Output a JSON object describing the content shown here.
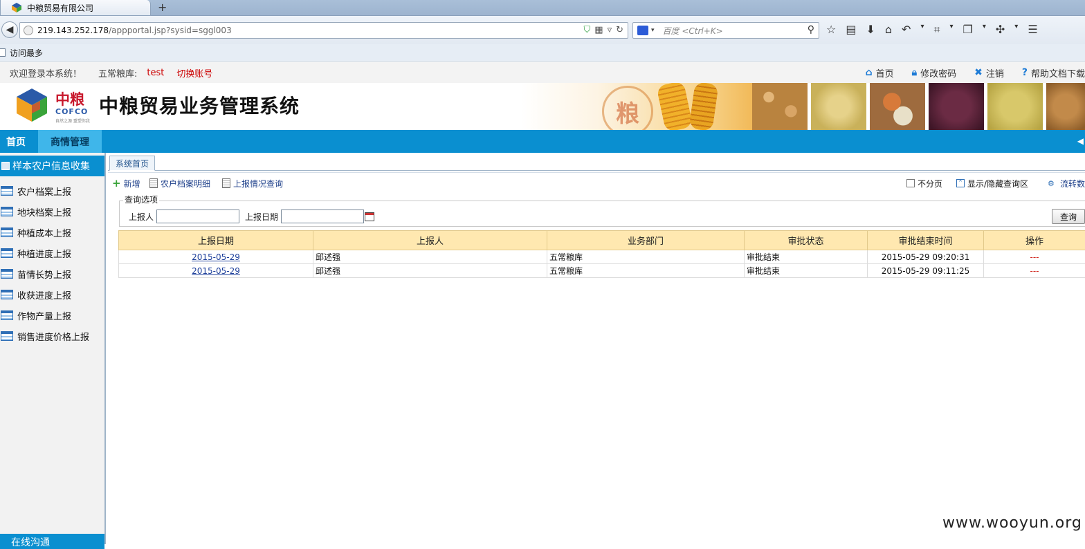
{
  "browser": {
    "tab_title": "中粮贸易有限公司",
    "new_tab": "+",
    "url_host": "219.143.252.178",
    "url_path": "/appportal.jsp?sysid=sggl003",
    "search_placeholder": "百度 <Ctrl+K>",
    "bookmark_label": "访问最多"
  },
  "topbar": {
    "welcome": "欢迎登录本系统！",
    "depot_label": "五常粮库:",
    "username": "test",
    "switch_account": "切换账号",
    "links": [
      {
        "label": "首页",
        "icon": "home-icon"
      },
      {
        "label": "修改密码",
        "icon": "lock-icon"
      },
      {
        "label": "注销",
        "icon": "close-icon"
      },
      {
        "label": "帮助文档下载",
        "icon": "help-icon"
      }
    ]
  },
  "banner": {
    "logo_cn": "中粮",
    "logo_en": "COFCO",
    "logo_tag": "自然之源 重塑你我",
    "system_title": "中粮贸易业务管理系统",
    "grain_char": "粮"
  },
  "menu": {
    "items": [
      "首页",
      "商情管理"
    ],
    "active": "商情管理"
  },
  "sidebar": {
    "header": "样本农户信息收集",
    "items": [
      "农户档案上报",
      "地块档案上报",
      "种植成本上报",
      "种植进度上报",
      "苗情长势上报",
      "收获进度上报",
      "作物产量上报",
      "销售进度价格上报"
    ],
    "footer": "在线沟通"
  },
  "content": {
    "tab": "系统首页",
    "actions": {
      "add": "新增",
      "farmer_detail": "农户档案明细",
      "report_query": "上报情况查询",
      "no_paging": "不分页",
      "toggle_query": "显示/隐藏查询区",
      "flow": "流转数"
    },
    "query": {
      "legend": "查询选项",
      "reporter_label": "上报人",
      "reporter_value": "",
      "date_label": "上报日期",
      "date_value": "",
      "button": "查询"
    },
    "table": {
      "headers": [
        "上报日期",
        "上报人",
        "业务部门",
        "审批状态",
        "审批结束时间",
        "操作"
      ],
      "rows": [
        [
          "2015-05-29",
          "邱述强",
          "五常粮库",
          "审批结束",
          "2015-05-29 09:20:31",
          "---"
        ],
        [
          "2015-05-29",
          "邱述强",
          "五常粮库",
          "审批结束",
          "2015-05-29 09:11:25",
          "---"
        ]
      ]
    }
  },
  "watermark": "www.wooyun.org",
  "colors": {
    "menu_blue": "#0a8fd0",
    "active_tab": "#3fb6ea",
    "header_row": "#ffe8b0",
    "link_red": "#cc0000"
  }
}
